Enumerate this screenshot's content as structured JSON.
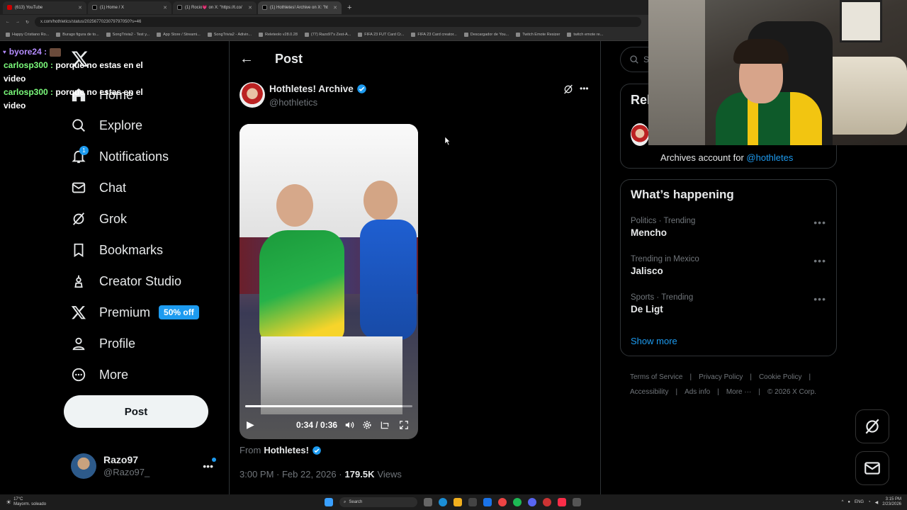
{
  "browser": {
    "tabs": [
      {
        "title": "(613) YouTube",
        "active": false
      },
      {
        "title": "(1) Home / X",
        "active": false
      },
      {
        "title": "(1) Rocio💗 on X: \"https://t.co/",
        "active": false
      },
      {
        "title": "(1) Hothletes! Archive on X: \"ht",
        "active": true
      }
    ],
    "url": "x.com/hothletics/status/2025677023079797050?s=46",
    "bookmarks": [
      "Happy Cristiano Ro...",
      "Burago figura de to...",
      "SongTrivia2 - Test y...",
      "App Store / Streami...",
      "SongTrivia2 - Adivin...",
      "Releteolo v28.0.28",
      "(77) Razo97's Zest-A...",
      "FIFA 23 FUT Card Cr...",
      "FIFA 23 Card creator...",
      "Descargador de You...",
      "Twitch Emote Resizer",
      "twitch emote re..."
    ]
  },
  "chat_overlay": [
    {
      "user": "byore24 :",
      "message": ""
    },
    {
      "user": "carlosp300 :",
      "message": "porque no estas en el video"
    },
    {
      "user": "carlosp300 :",
      "message": "porque no estas en el video"
    }
  ],
  "sidebar": {
    "items": [
      {
        "label": "Home"
      },
      {
        "label": "Explore"
      },
      {
        "label": "Notifications",
        "badge": "1"
      },
      {
        "label": "Chat"
      },
      {
        "label": "Grok"
      },
      {
        "label": "Bookmarks"
      },
      {
        "label": "Creator Studio"
      },
      {
        "label": "Premium",
        "pill": "50% off"
      },
      {
        "label": "Profile"
      },
      {
        "label": "More"
      }
    ],
    "post_button": "Post",
    "account": {
      "name": "Razo97",
      "handle": "@Razo97_"
    }
  },
  "post": {
    "header_title": "Post",
    "author_name": "Hothletes! Archive",
    "author_handle": "@hothletics",
    "video": {
      "time": "0:34 / 0:36",
      "progress": 0.94
    },
    "from_label": "From",
    "from_name": "Hothletes!",
    "timestamp": "3:00 PM · Feb 22, 2026 ·",
    "views_count": "179.5K",
    "views_label": "Views"
  },
  "right": {
    "search_placeholder": "Se",
    "relevant_partial": "Rel",
    "archive_desc": "Archives account for",
    "archive_link": "@hothletes",
    "whats_happening": "What’s happening",
    "trends": [
      {
        "meta": "Politics · Trending",
        "name": "Mencho"
      },
      {
        "meta": "Trending in Mexico",
        "name": "Jalisco"
      },
      {
        "meta": "Sports · Trending",
        "name": "De Ligt"
      }
    ],
    "show_more": "Show more",
    "footer": [
      "Terms of Service",
      "Privacy Policy",
      "Cookie Policy",
      "Accessibility",
      "Ads info",
      "More ···",
      "© 2026 X Corp."
    ]
  },
  "taskbar": {
    "weather_temp": "17°C",
    "weather_desc": "Mayorm. soleado",
    "search": "Search",
    "lang": "ENG",
    "time": "3:15 PM",
    "date": "2/23/2026"
  },
  "colors": {
    "accent": "#1d9bf0",
    "background": "#000000",
    "border": "#2f3336",
    "muted": "#71767b"
  }
}
